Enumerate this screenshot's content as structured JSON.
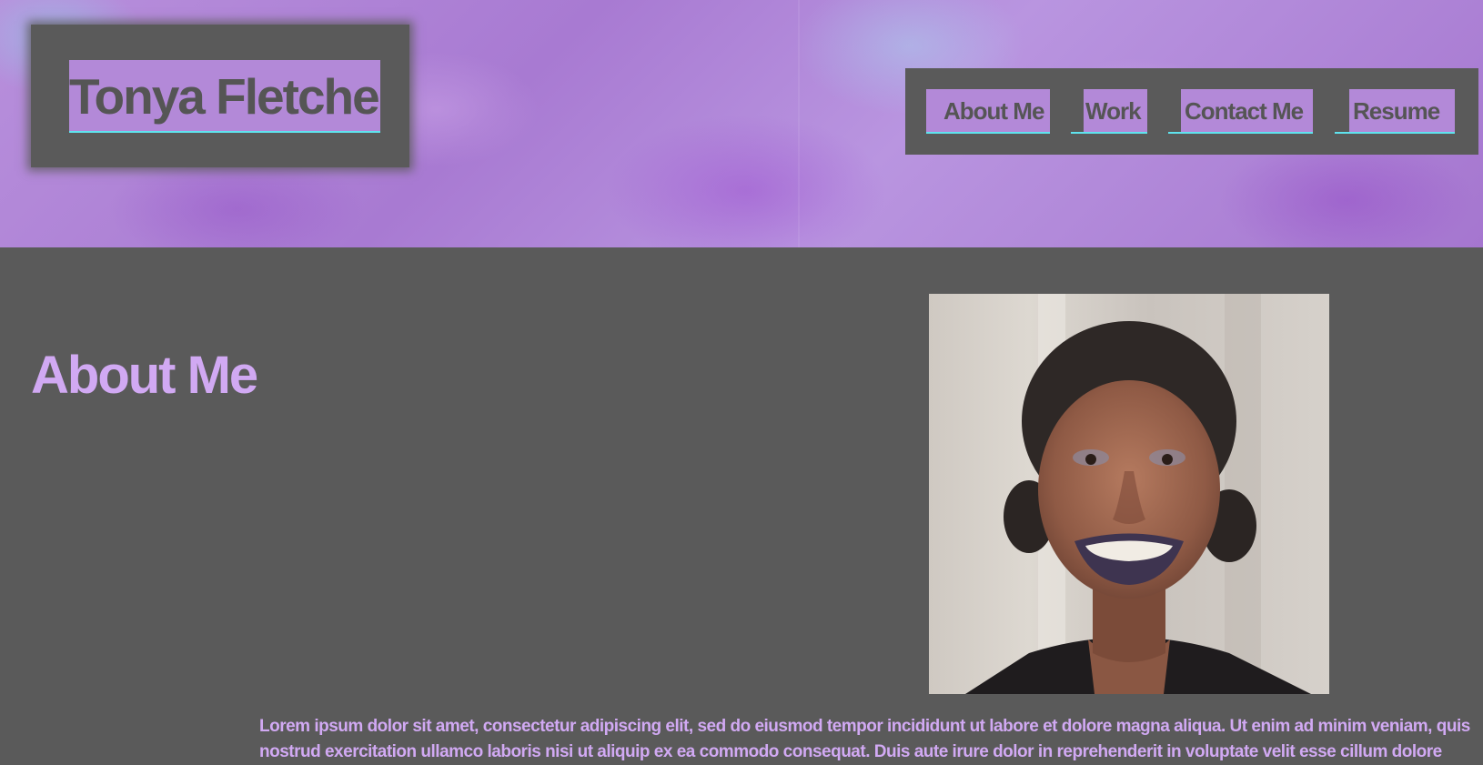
{
  "header": {
    "site_title": "Tonya Fletcher",
    "nav": [
      {
        "label": "About Me"
      },
      {
        "label": "Work"
      },
      {
        "label": "Contact Me"
      },
      {
        "label": "Resume"
      }
    ]
  },
  "about": {
    "heading": "About Me",
    "photo_alt": "Portrait of Tonya Fletcher",
    "body_lines": [
      "Lorem ipsum dolor sit amet, consectetur adipiscing elit, sed do eiusmod tempor incididunt ut labore et dolore magna aliqua. Ut enim ad minim veniam, quis",
      "nostrud exercitation ullamco laboris nisi ut aliquip ex ea commodo consequat. Duis aute irure dolor in reprehenderit in voluptate velit esse cillum dolore"
    ]
  },
  "colors": {
    "background": "#5a5a5a",
    "accent_purple": "#b389d8",
    "heading_lavender": "#d1a9f3",
    "underline_cyan": "#5fe3ee"
  }
}
